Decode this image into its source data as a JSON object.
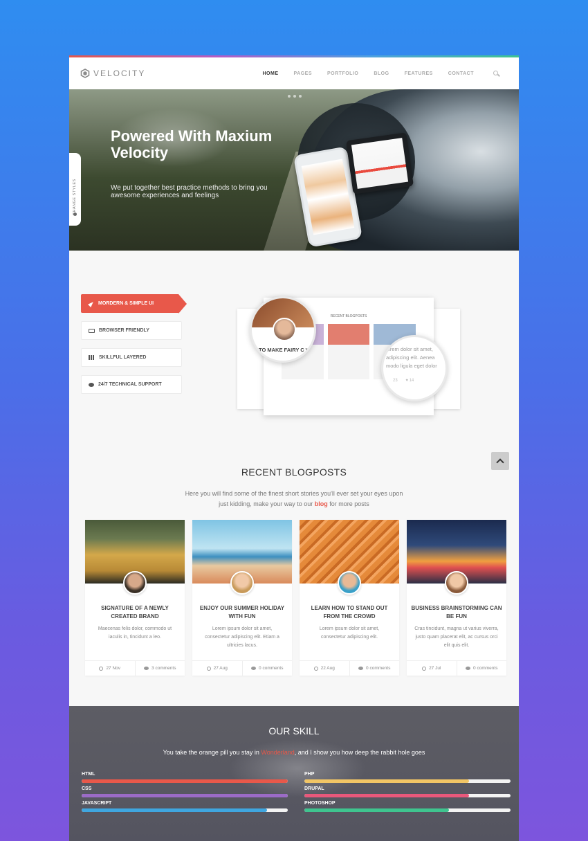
{
  "brand": {
    "name": "VELOCITY"
  },
  "nav": {
    "items": [
      "HOME",
      "PAGES",
      "PORTFOLIO",
      "BLOG",
      "FEATURES",
      "CONTACT"
    ],
    "active": "HOME"
  },
  "hero": {
    "title": "Powered With Maxium Velocity",
    "subtitle": "We put together best practice methods to bring you awesome experiences and feelings",
    "side_tab": "CHANGE STYLES"
  },
  "features": {
    "items": [
      {
        "label": "MORDERN & SIMPLE UI",
        "icon": "rocket-icon",
        "active": true
      },
      {
        "label": "BROWSER FRIENDLY",
        "icon": "monitor-icon",
        "active": false
      },
      {
        "label": "SKILLFUL LAYERED",
        "icon": "layers-icon",
        "active": false
      },
      {
        "label": "24/7 TECHNICAL SUPPORT",
        "icon": "chat-icon",
        "active": false
      }
    ],
    "mockup": {
      "title": "RECENT BLOGPOSTS",
      "lens_left_text": "TO MAKE FAIRY C WITH PIXEL",
      "lens_right_text_1": "lorem dolor sit amet,",
      "lens_right_text_2": "adipiscing elit. Aenea",
      "lens_right_text_3": "modo ligula eget dolor",
      "lens_right_comments": "23",
      "lens_right_likes": "14"
    }
  },
  "blog": {
    "title": "RECENT BLOGPOSTS",
    "desc_1": "Here you will find some of the finest short stories you'll ever set your eyes upon",
    "desc_2": "just kidding, make your way to our",
    "desc_link": "blog",
    "desc_3": "for more posts",
    "posts": [
      {
        "title": "SIGNATURE OF A NEWLY CREATED BRAND",
        "text": "Maecenas felis dolor, commodo ut iaculis in, tincidunt a leo.",
        "date": "27 Nov",
        "comments": "3 comments"
      },
      {
        "title": "ENJOY OUR SUMMER HOLIDAY WITH FUN",
        "text": "Lorem ipsum dolor sit amet, consectetur adipiscing elit. Etiam a ultricies lacus.",
        "date": "27 Aug",
        "comments": "0 comments"
      },
      {
        "title": "LEARN HOW TO STAND OUT FROM THE CROWD",
        "text": "Lorem ipsum dolor sit amet, consectetur adipiscing elit.",
        "date": "22 Aug",
        "comments": "0 comments"
      },
      {
        "title": "BUSINESS BRAINSTORMING CAN BE FUN",
        "text": "Cras tincidunt, magna ut varius viverra, justo quam placerat elit, ac cursus orci elit quis elit.",
        "date": "27 Jul",
        "comments": "0 comments"
      }
    ]
  },
  "skill": {
    "title": "OUR SKILL",
    "desc_1": "You take the orange pill you stay in",
    "desc_hl": "Wonderland",
    "desc_2": ", and I show you how deep the rabbit hole goes",
    "bars": [
      {
        "label": "HTML",
        "value": 1.0,
        "color": "#e8584a"
      },
      {
        "label": "CSS",
        "value": 1.0,
        "color": "#9b6bc7"
      },
      {
        "label": "JAVASCRIPT",
        "value": 0.9,
        "color": "#3fa6e0"
      },
      {
        "label": "PHP",
        "value": 0.8,
        "color": "#f1c565"
      },
      {
        "label": "DRUPAL",
        "value": 0.8,
        "color": "#e8587b"
      },
      {
        "label": "PHOTOSHOP",
        "value": 0.7,
        "color": "#3fc48f"
      }
    ]
  }
}
